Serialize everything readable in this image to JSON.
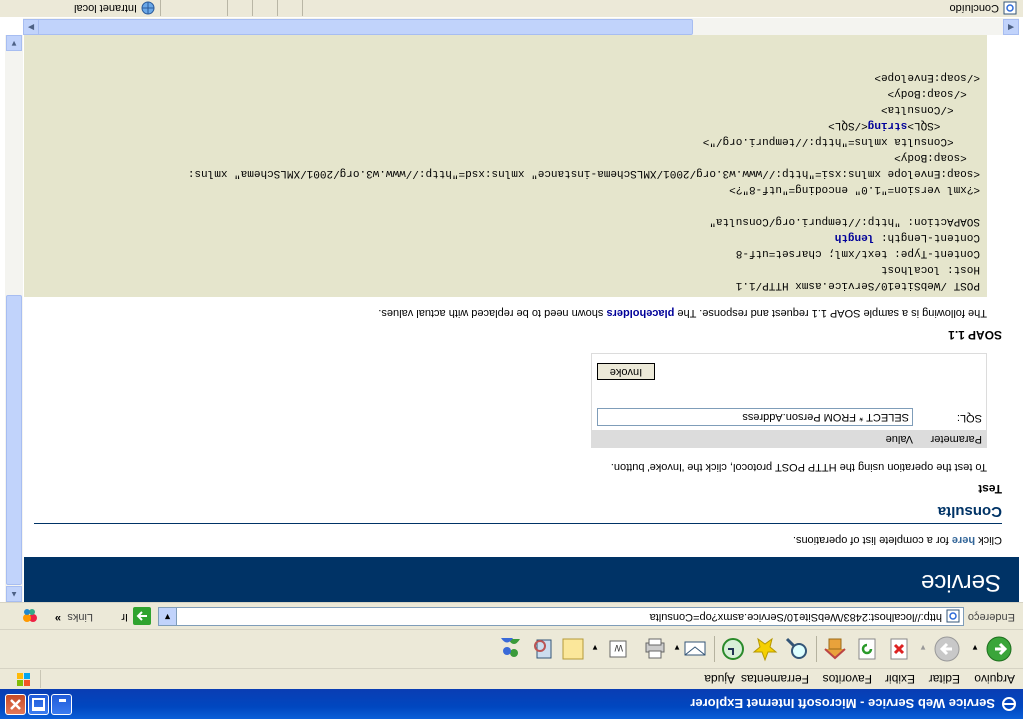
{
  "window": {
    "title": "Service Web Service - Microsoft Internet Explorer"
  },
  "menu": {
    "items": [
      "Arquivo",
      "Editar",
      "Exibir",
      "Favoritos",
      "Ferramentas",
      "Ajuda"
    ]
  },
  "toolbar": {
    "buttons": [
      "back-icon",
      "forward-icon",
      "stop-icon",
      "refresh-icon",
      "home-icon",
      "search-icon",
      "favorites-icon",
      "history-icon",
      "mail-icon",
      "print-icon",
      "edit-icon",
      "discuss-icon",
      "research-icon",
      "messenger-icon"
    ]
  },
  "address": {
    "label": "Endereço",
    "url": "http://localhost:2483/WebSite10/Service.asmx?op=Consulta",
    "go_label": "Ir",
    "links_label": "Links"
  },
  "page": {
    "banner_title": "Service",
    "intro_prefix": "Click ",
    "intro_link": "here",
    "intro_suffix": " for a complete list of operations.",
    "operation_title": "Consulta",
    "test_heading": "Test",
    "test_text": "To test the operation using the HTTP POST protocol, click the 'Invoke' button.",
    "form": {
      "col_parameter": "Parameter",
      "col_value": "Value",
      "param_label": "SQL:",
      "param_value": "SELECT * FROM Person.Address",
      "invoke_label": "Invoke"
    },
    "soap_heading": "SOAP 1.1",
    "soap_text_prefix": "The following is a sample SOAP 1.1 request and response. The ",
    "soap_text_link": "placeholders",
    "soap_text_suffix": " shown need to be replaced with actual values.",
    "code": {
      "line1": "POST /WebSite10/Service.asmx HTTP/1.1",
      "line2": "Host: localhost",
      "line3": "Content-Type: text/xml; charset=utf-8",
      "line4_prefix": "Content-Length: ",
      "line4_ph": "length",
      "line5": "SOAPAction: \"http://tempuri.org/Consulta\"",
      "line6": "<?xml version=\"1.0\" encoding=\"utf-8\"?>",
      "line7": "<soap:Envelope xmlns:xsi=\"http://www.w3.org/2001/XMLSchema-instance\" xmlns:xsd=\"http://www.w3.org/2001/XMLSchema\" xmlns:",
      "line8": "  <soap:Body>",
      "line9": "    <Consulta xmlns=\"http://tempuri.org/\">",
      "line10_prefix": "      <SQL>",
      "line10_ph": "string",
      "line10_suffix": "</SQL>",
      "line11": "    </Consulta>",
      "line12": "  </soap:Body>",
      "line13": "</soap:Envelope>"
    }
  },
  "status": {
    "text": "Concluído",
    "zone": "Intranet local"
  },
  "colors": {
    "banner": "#003366",
    "code_bg": "#e5e5cc",
    "title_bar": "#0047c0",
    "chrome": "#ece9d8"
  }
}
